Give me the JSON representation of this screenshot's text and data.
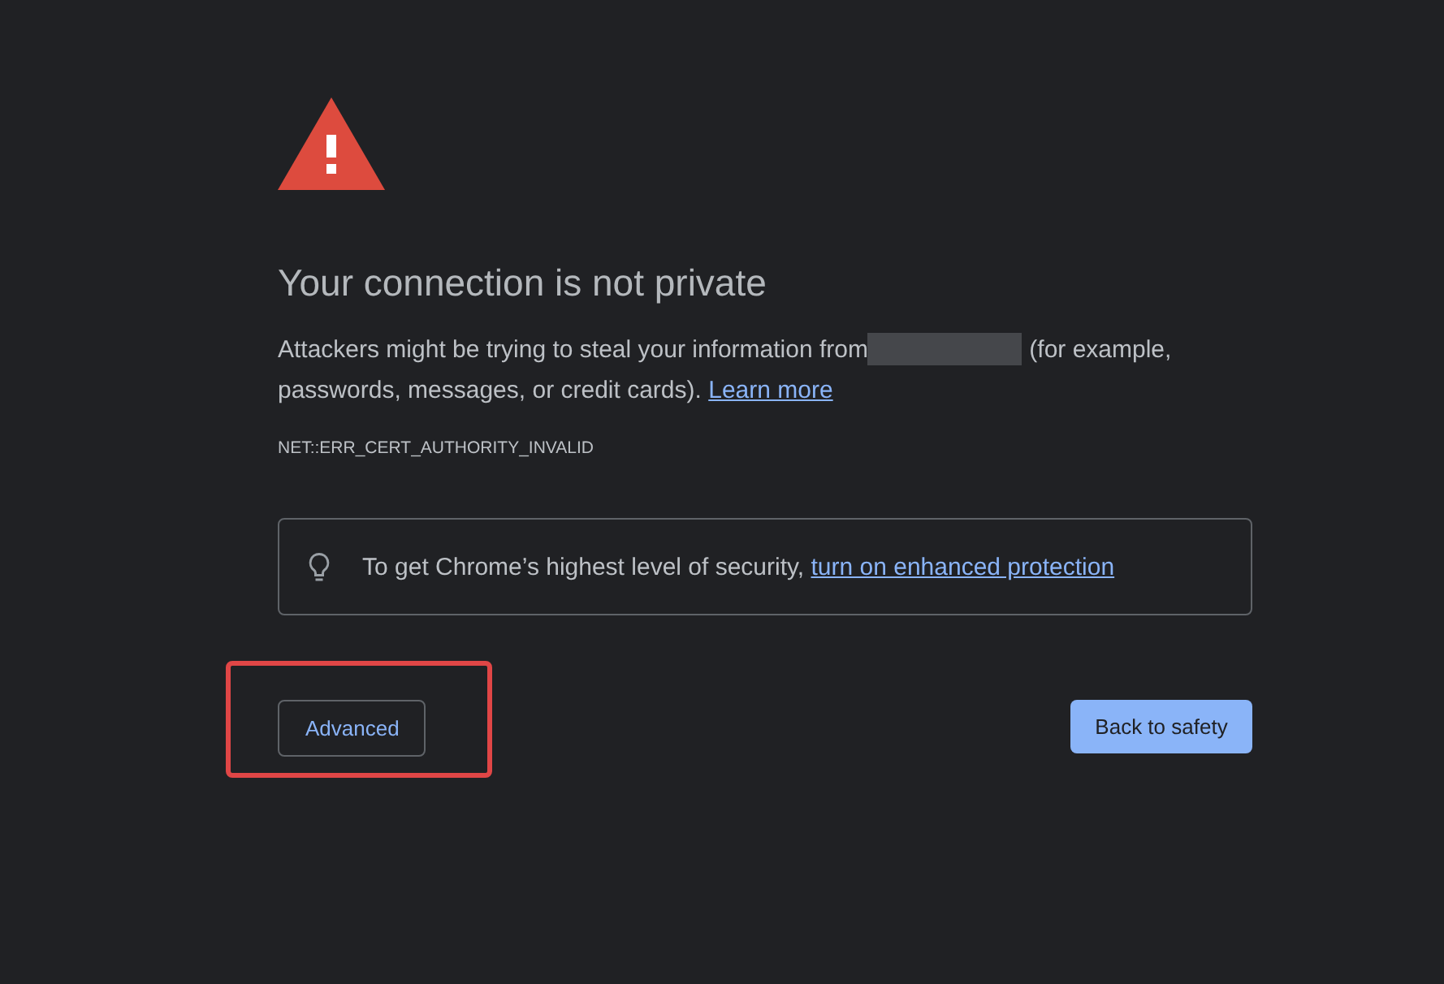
{
  "title": "Your connection is not private",
  "description": {
    "text_before": "Attackers might be trying to steal your information from",
    "host_redacted": true,
    "text_after": "(for example, passwords, messages, or credit cards).",
    "link": "Learn more"
  },
  "error_code": "NET::ERR_CERT_AUTHORITY_INVALID",
  "protection_notice": {
    "text": "To get Chrome’s highest level of security,",
    "link": "turn on enhanced protection"
  },
  "buttons": [
    {
      "label": "Advanced",
      "kind": "secondary",
      "highlighted": true
    },
    {
      "label": "Back to safety",
      "kind": "primary",
      "highlighted": false
    }
  ]
}
